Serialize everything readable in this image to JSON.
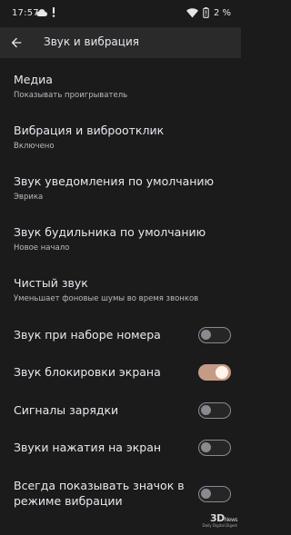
{
  "status_bar": {
    "time": "17:57",
    "left_icons": [
      "cloud-icon",
      "exclamation-icon"
    ],
    "right_icons": [
      "wifi-icon",
      "battery-icon"
    ],
    "battery": "2 %"
  },
  "header": {
    "title": "Звук и вибрация",
    "back_icon": "arrow-left-icon"
  },
  "items": [
    {
      "title": "Медиа",
      "subtitle": "Показывать проигрыватель"
    },
    {
      "title": "Вибрация и виброотклик",
      "subtitle": "Включено"
    },
    {
      "title": "Звук уведомления по умолчанию",
      "subtitle": "Эврика"
    },
    {
      "title": "Звук будильника по умолчанию",
      "subtitle": "Новое начало"
    },
    {
      "title": "Чистый звук",
      "subtitle": "Уменьшает фоновые шумы во время звонков"
    }
  ],
  "toggles": [
    {
      "label": "Звук при наборе номера",
      "on": false
    },
    {
      "label": "Звук блокировки экрана",
      "on": true
    },
    {
      "label": "Сигналы зарядки",
      "on": false
    },
    {
      "label": "Звуки нажатия на экран",
      "on": false
    },
    {
      "label_line1": "Всегда показывать значок в",
      "label_line2": "режиме вибрации",
      "on": false
    }
  ],
  "colors": {
    "background": "#1b1b1b",
    "header": "#2a2a2b",
    "toggle_on": "#c59b86"
  },
  "watermark": {
    "logo": "3D",
    "logo_suffix": "News",
    "tagline": "Daily Digital Digest"
  }
}
